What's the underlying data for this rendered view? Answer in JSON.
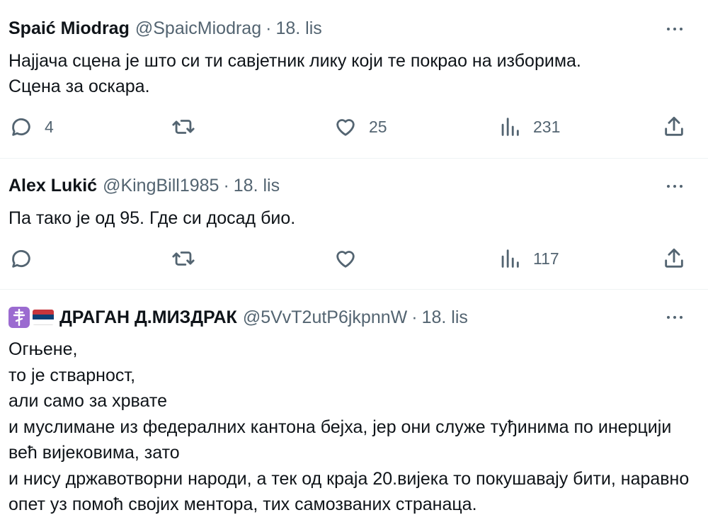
{
  "tweets": [
    {
      "name": "Spaić Miodrag",
      "handle": "@SpaicMiodrag",
      "separator": "·",
      "date": "18. lis",
      "text": "Најјача сцена је што си ти савјетник лику који те покрао на изборима.\nСцена за оскара.",
      "replies": "4",
      "reposts": "",
      "likes": "25",
      "views": "231"
    },
    {
      "name": "Alex Lukić",
      "handle": "@KingBill1985",
      "separator": "·",
      "date": "18. lis",
      "text": "Па тако је од 95. Где си досад био.",
      "replies": "",
      "reposts": "",
      "likes": "",
      "views": "117"
    },
    {
      "name": "ДРАГАН Д.МИЗДРАК",
      "handle": "@5VvT2utP6jkpnnW",
      "separator": "·",
      "date": "18. lis",
      "text": "Огњене,\nто је стварност,\nали само за хрвате\nи муслимане из федералних кантона бејха, јер они служе туђинима по инерцији већ вијековима, зато\nи нису државотворни народи, а тек од краја 20.вијека то покушавају бити, наравно опет уз помоћ својих ментора, тих самозваних странаца."
    }
  ],
  "icons": {
    "reply": "reply-icon",
    "repost": "repost-icon",
    "like": "heart-icon",
    "views": "views-icon",
    "share": "share-icon",
    "more": "more-icon",
    "orthodox_cross": "orthodox-cross-icon",
    "flag": "serbian-flag-icon"
  },
  "colors": {
    "text": "#0f1419",
    "secondary": "#536471",
    "divider": "#eff3f4",
    "cross_badge": "#9b6bd0",
    "flag_red": "#c6363c",
    "flag_blue": "#0c4076",
    "flag_white": "#ffffff"
  }
}
